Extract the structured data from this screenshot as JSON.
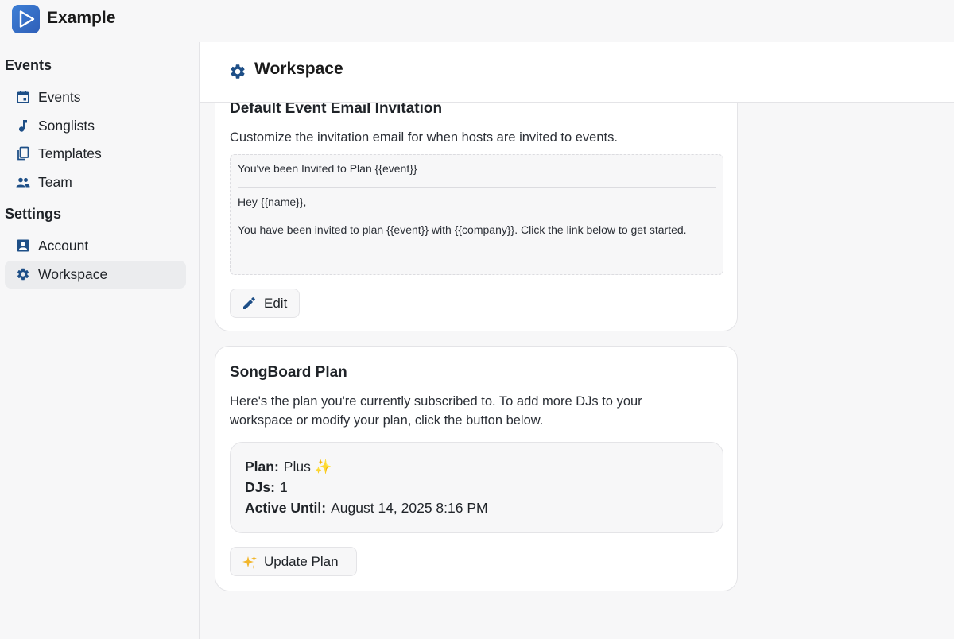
{
  "app": {
    "brand": "Example"
  },
  "sidebar": {
    "sections": [
      {
        "title": "Events",
        "items": [
          {
            "label": "Events",
            "icon": "calendar-icon"
          },
          {
            "label": "Songlists",
            "icon": "music-note-icon"
          },
          {
            "label": "Templates",
            "icon": "copy-icon"
          },
          {
            "label": "Team",
            "icon": "people-icon"
          }
        ]
      },
      {
        "title": "Settings",
        "items": [
          {
            "label": "Account",
            "icon": "account-box-icon"
          },
          {
            "label": "Workspace",
            "icon": "gear-icon",
            "active": true
          }
        ]
      }
    ]
  },
  "header": {
    "title": "Workspace",
    "icon": "gear-icon"
  },
  "email_card": {
    "title": "Default Event Email Invitation",
    "description": "Customize the invitation email for when hosts are invited to events.",
    "subject": "You've been Invited to Plan {{event}}",
    "greeting": "Hey {{name}},",
    "body": "You have been invited to plan {{event}} with {{company}}. Click the link below to get started.",
    "edit_label": "Edit"
  },
  "plan_card": {
    "title": "SongBoard Plan",
    "description": "Here's the plan you're currently subscribed to. To add more DJs to your workspace or modify your plan, click the button below.",
    "plan_label": "Plan:",
    "plan_value": "Plus ✨",
    "djs_label": "DJs:",
    "djs_value": "1",
    "active_label": "Active Until:",
    "active_value": "August 14, 2025 8:16 PM",
    "update_label": "Update Plan"
  },
  "colors": {
    "accent": "#1e4f87",
    "logo": "#3d7fd6",
    "sparkle": "#f2b62b"
  }
}
